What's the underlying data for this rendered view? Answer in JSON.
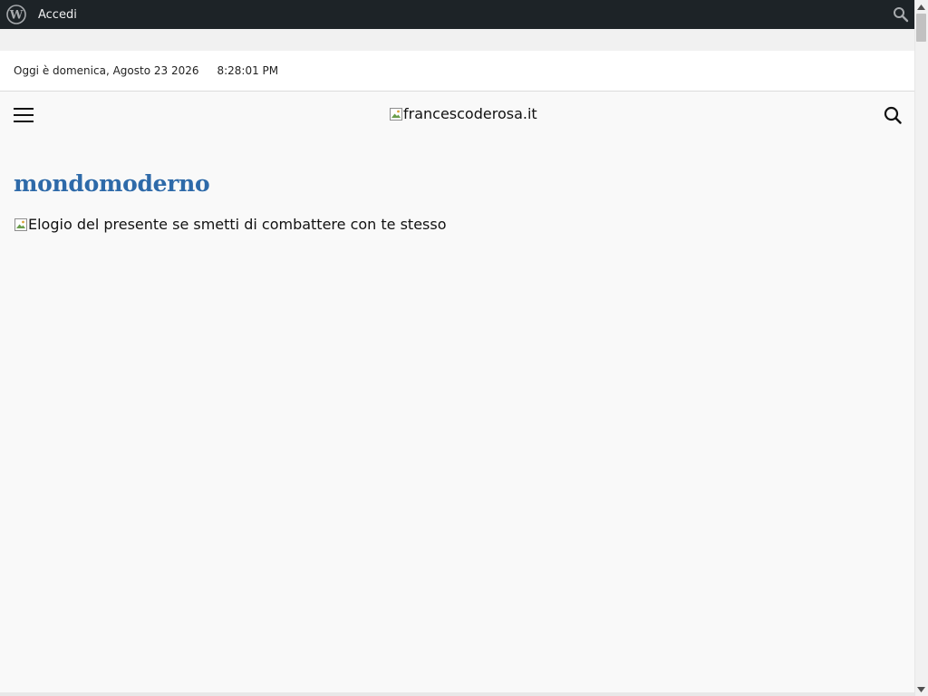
{
  "admin_bar": {
    "login_label": "Accedi"
  },
  "top_bar": {
    "date_text": "Oggi è domenica, Agosto 23 2026",
    "time_text": "8:28:01 PM"
  },
  "header": {
    "logo_alt": "francescoderosa.it"
  },
  "archive": {
    "title": "mondomoderno"
  },
  "post": {
    "image_alt": "Elogio del presente se smetti di combattere con te stesso"
  },
  "colors": {
    "admin_bar_bg": "#1d2327",
    "title_accent": "#2e6aa9",
    "page_bg": "#f9f9f9"
  },
  "icons": [
    "wordpress-logo-icon",
    "search-icon",
    "hamburger-menu-icon",
    "broken-image-icon",
    "scroll-up-arrow-icon",
    "scroll-down-arrow-icon"
  ]
}
